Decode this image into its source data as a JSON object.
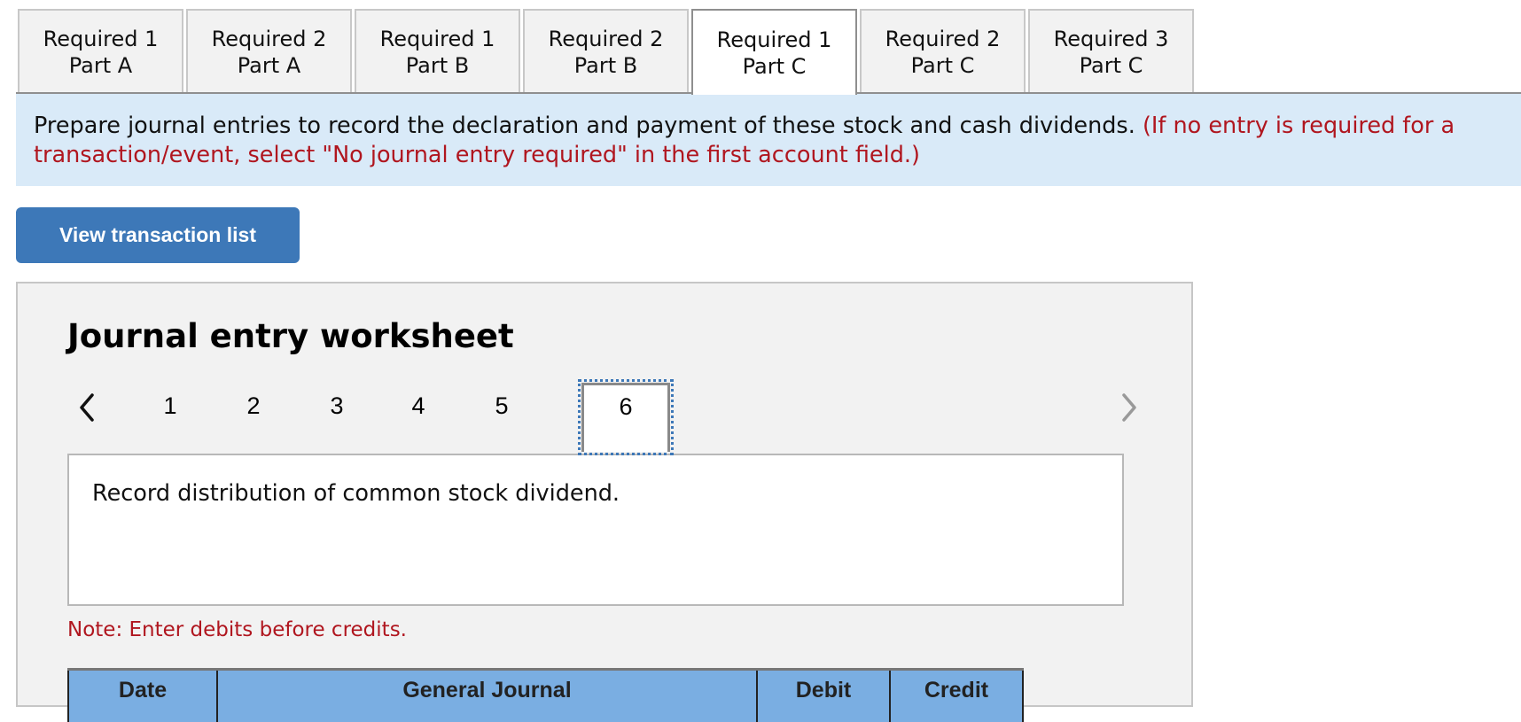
{
  "tabs": [
    {
      "line1": "Required 1",
      "line2": "Part A",
      "active": false
    },
    {
      "line1": "Required 2",
      "line2": "Part A",
      "active": false
    },
    {
      "line1": "Required 1",
      "line2": "Part B",
      "active": false
    },
    {
      "line1": "Required 2",
      "line2": "Part B",
      "active": false
    },
    {
      "line1": "Required 1",
      "line2": "Part C",
      "active": true
    },
    {
      "line1": "Required 2",
      "line2": "Part C",
      "active": false
    },
    {
      "line1": "Required 3",
      "line2": "Part C",
      "active": false
    }
  ],
  "instructions": {
    "main": "Prepare journal entries to record the declaration and payment of these stock and cash dividends.",
    "hint": "(If no entry is required for a transaction/event, select \"No journal entry required\" in the first account field.)"
  },
  "buttons": {
    "view_transaction_list": "View transaction list"
  },
  "worksheet": {
    "title": "Journal entry worksheet",
    "pages": [
      "1",
      "2",
      "3",
      "4",
      "5",
      "6"
    ],
    "current_page": "6",
    "prev_icon": "chevron-left-icon",
    "next_icon": "chevron-right-icon",
    "description": "Record distribution of common stock dividend.",
    "note": "Note: Enter debits before credits.",
    "table": {
      "headers": [
        "Date",
        "General Journal",
        "Debit",
        "Credit"
      ]
    }
  },
  "colors": {
    "accent_button": "#3d78b8",
    "instruction_bg": "#d9eaf8",
    "hint_red": "#b0161f",
    "table_header": "#7aaee2"
  }
}
